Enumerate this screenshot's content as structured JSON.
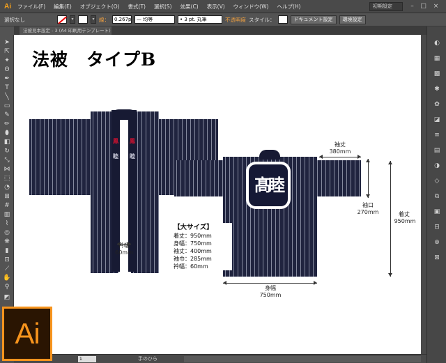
{
  "app": {
    "logo": "Ai"
  },
  "menu": [
    "ファイル(F)",
    "編集(E)",
    "オブジェクト(O)",
    "書式(T)",
    "選択(S)",
    "効果(C)",
    "表示(V)",
    "ウィンドウ(W)",
    "ヘルプ(H)"
  ],
  "workspace": "初期設定",
  "control": {
    "selection": "選択なし",
    "stroke_label": "線：",
    "stroke_width": "0.267",
    "stroke_width_unit": "p",
    "profile": "均等",
    "brush": "3 pt. 丸筆",
    "opacity": "不透明度",
    "style": "スタイル：",
    "doc_setup": "ドキュメント設定",
    "prefs": "環境設定"
  },
  "document": {
    "tab_label": "法被見本設定 - 3 (A4 印刷用テンプレート)"
  },
  "artboard": {
    "title": "法被　タイプB",
    "size_info": {
      "heading": "【大サイズ】",
      "lines": [
        "着丈：950mm",
        "身幅：750mm",
        "袖丈：400mm",
        "袖巾：285mm",
        "衿幅：60mm"
      ]
    },
    "dims": {
      "collar_label": "衿幅",
      "collar_value": "60mm",
      "sleeve_len_label": "袖丈",
      "sleeve_len_value": "380mm",
      "cuff_label": "袖口",
      "cuff_value": "270mm",
      "length_label": "着丈",
      "length_value": "950mm",
      "width_label": "身幅",
      "width_value": "750mm"
    },
    "emblem_text": "髙睦",
    "collar_top": "鳳",
    "collar_bottom": "睦"
  },
  "status": {
    "page": "1",
    "tool": "手のひら"
  },
  "colors": {
    "happi_navy": "#20243f",
    "accent": "#f7941d",
    "collar_red": "#c41230"
  }
}
